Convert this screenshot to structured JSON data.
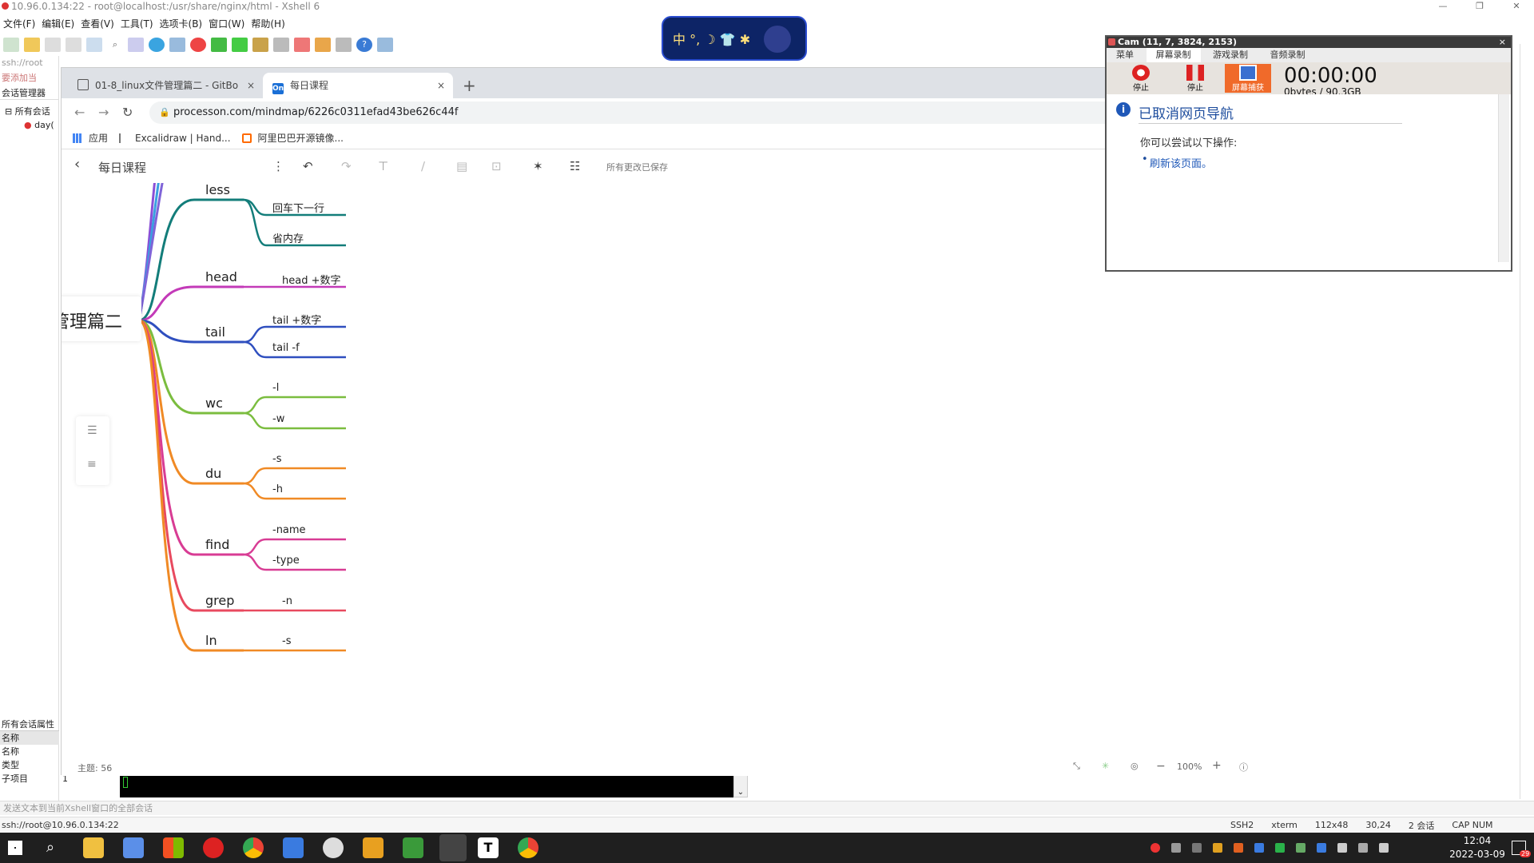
{
  "xshell": {
    "title": "10.96.0.134:22 - root@localhost:/usr/share/nginx/html - Xshell 6",
    "menu": [
      "文件(F)",
      "编辑(E)",
      "查看(V)",
      "工具(T)",
      "选项卡(B)",
      "窗口(W)",
      "帮助(H)"
    ],
    "session_path": "ssh://root",
    "link_text": "要添加当",
    "session_manager": "会话管理器",
    "tree_root": "所有会话",
    "tree_child": "day(",
    "props_header": "所有会话属性",
    "props": [
      {
        "k": "名称",
        "v": ""
      },
      {
        "k": "名称",
        "v": ""
      },
      {
        "k": "类型",
        "v": ""
      },
      {
        "k": "子项目",
        "v": "1"
      }
    ],
    "send_text": "发送文本到当前Xshell窗口的全部会话",
    "status_left": "ssh://root@10.96.0.134:22",
    "status_right": [
      "SSH2",
      "xterm",
      "112x48",
      "30,24",
      "2 会话",
      "CAP NUM"
    ]
  },
  "browser": {
    "tabs": [
      {
        "label": "01-8_linux文件管理篇二 - GitBo",
        "close": "×",
        "favicon": "book-icon"
      },
      {
        "label": "每日课程",
        "close": "×",
        "favicon": "On"
      }
    ],
    "new_tab": "+",
    "url": "processon.com/mindmap/6226c0311efad43be626c44f",
    "bookmarks": [
      "应用",
      "Excalidraw | Hand...",
      "阿里巴巴开源镜像..."
    ]
  },
  "mindmap": {
    "back": "‹",
    "doc_title": "每日课程",
    "saved": "所有更改已保存",
    "root_partial": "管理篇二",
    "topics_label": "主题: 56",
    "zoom": "100%",
    "branches": [
      {
        "label": "less",
        "color": "#137d7a",
        "leaves": [
          "回车下一行",
          "省内存"
        ]
      },
      {
        "label": "head",
        "color": "#c33ab8",
        "leaves": [
          "head +数字"
        ]
      },
      {
        "label": "tail",
        "color": "#2f4fbf",
        "leaves": [
          "tail +数字",
          "tail -f"
        ]
      },
      {
        "label": "wc",
        "color": "#7bbd3f",
        "leaves": [
          "-l",
          "-w"
        ]
      },
      {
        "label": "du",
        "color": "#f08a25",
        "leaves": [
          "-s",
          "-h"
        ]
      },
      {
        "label": "find",
        "color": "#d83c94",
        "leaves": [
          "-name",
          "-type"
        ]
      },
      {
        "label": "grep",
        "color": "#e84a5f",
        "leaves": [
          "-n"
        ]
      },
      {
        "label": "ln",
        "color": "#f08a25",
        "leaves": [
          "-s"
        ]
      }
    ]
  },
  "cam": {
    "title": "Cam (11, 7, 3824, 2153)",
    "tabs": [
      "菜单",
      "屏幕录制",
      "游戏录制",
      "音频录制"
    ],
    "buttons": [
      "停止",
      "停止",
      "屏幕捕获"
    ],
    "timer": "00:00:00",
    "bytes": "0bytes / 90.3GB",
    "error_title": "已取消网页导航",
    "hint": "你可以尝试以下操作:",
    "action": "刷新该页面。"
  },
  "moon": {
    "text": "中 °, ☽ 👕 ✱"
  },
  "taskbar": {
    "time": "12:04",
    "date": "2022-03-09",
    "badge": "29"
  }
}
